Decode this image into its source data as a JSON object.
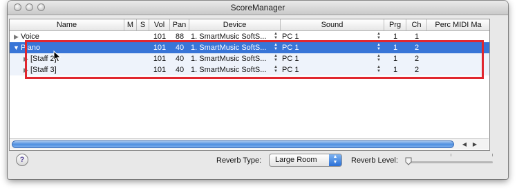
{
  "window": {
    "title": "ScoreManager"
  },
  "table": {
    "columns": [
      "Name",
      "M",
      "S",
      "Vol",
      "Pan",
      "Device",
      "Sound",
      "Prg",
      "Ch",
      "Perc MIDI Ma"
    ],
    "rows": [
      {
        "name": "Voice",
        "vol": "101",
        "pan": "88",
        "device": "1. SmartMusic SoftS...",
        "sound": "PC 1",
        "prg": "1",
        "ch": "1"
      },
      {
        "name": "Piano",
        "vol": "101",
        "pan": "40",
        "device": "1. SmartMusic SoftS...",
        "sound": "PC 1",
        "prg": "1",
        "ch": "2"
      },
      {
        "name": "[Staff 2]",
        "vol": "101",
        "pan": "40",
        "device": "1. SmartMusic SoftS...",
        "sound": "PC 1",
        "prg": "1",
        "ch": "2"
      },
      {
        "name": "[Staff 3]",
        "vol": "101",
        "pan": "40",
        "device": "1. SmartMusic SoftS...",
        "sound": "PC 1",
        "prg": "1",
        "ch": "2"
      }
    ]
  },
  "footer": {
    "help": "?",
    "reverb_type_label": "Reverb Type:",
    "reverb_type_value": "Large Room",
    "reverb_level_label": "Reverb Level:",
    "reverb_level": 0
  },
  "colors": {
    "selection": "#3875d7",
    "highlight": "#e0262e"
  }
}
